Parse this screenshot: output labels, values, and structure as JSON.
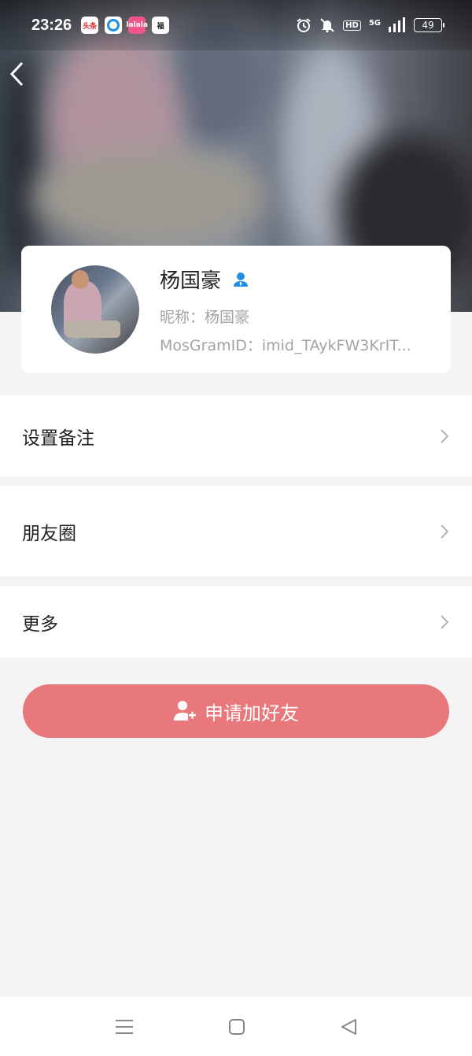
{
  "status_bar": {
    "time": "23:26",
    "app_icons": [
      "头条",
      "",
      "lalala",
      "福"
    ],
    "battery": "49",
    "network": "5G",
    "hd_label": "HD"
  },
  "profile": {
    "name": "杨国豪",
    "nickname": "昵称：杨国豪",
    "mosgram_id": "MosGramID：imid_TAykFW3KrIT..."
  },
  "menu": {
    "remark": "设置备注",
    "moments": "朋友圈",
    "more": "更多"
  },
  "actions": {
    "add_friend": "申请加好友"
  },
  "colors": {
    "accent": "#e8787b",
    "verified_icon": "#1f8fe6"
  }
}
